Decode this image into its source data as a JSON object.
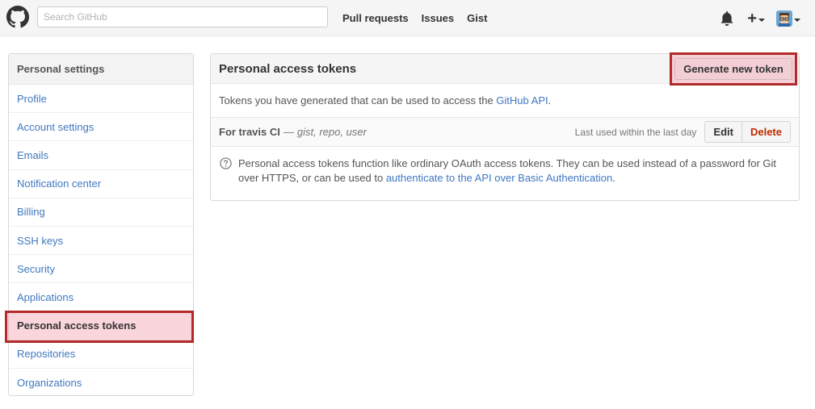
{
  "header": {
    "search_placeholder": "Search GitHub",
    "nav": [
      "Pull requests",
      "Issues",
      "Gist"
    ],
    "plus_symbol": "+"
  },
  "sidebar": {
    "heading": "Personal settings",
    "items": [
      {
        "label": "Profile"
      },
      {
        "label": "Account settings"
      },
      {
        "label": "Emails"
      },
      {
        "label": "Notification center"
      },
      {
        "label": "Billing"
      },
      {
        "label": "SSH keys"
      },
      {
        "label": "Security"
      },
      {
        "label": "Applications"
      },
      {
        "label": "Personal access tokens"
      },
      {
        "label": "Repositories"
      },
      {
        "label": "Organizations"
      }
    ],
    "selected_index": 8
  },
  "main": {
    "title": "Personal access tokens",
    "generate_label": "Generate new token",
    "description_prefix": "Tokens you have generated that can be used to access the ",
    "description_link": "GitHub API",
    "description_suffix": ".",
    "token": {
      "name": "For travis CI",
      "separator": "—",
      "scopes": "gist, repo, user",
      "last_used": "Last used within the last day",
      "edit_label": "Edit",
      "delete_label": "Delete"
    },
    "help_prefix": "Personal access tokens function like ordinary OAuth access tokens. They can be used instead of a password for Git over HTTPS, or can be used to ",
    "help_link": "authenticate to the API over Basic Authentication",
    "help_suffix": "."
  },
  "colors": {
    "link": "#4078c0",
    "highlight_border": "#b32a2a",
    "delete_text": "#bd2c00"
  }
}
